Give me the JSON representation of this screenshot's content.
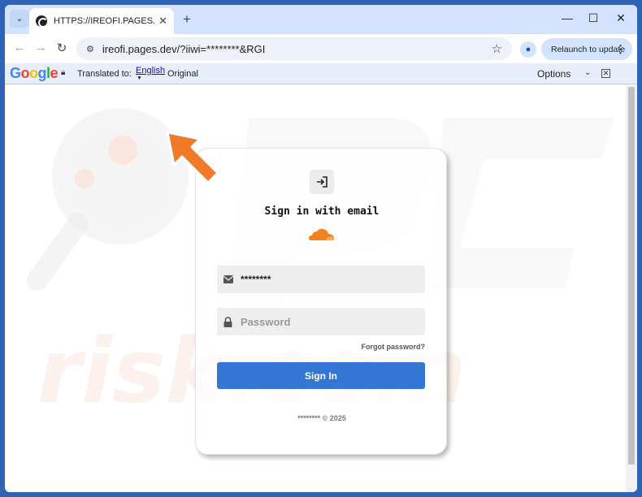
{
  "tab": {
    "title": "HTTPS://IREOFI.PAGES.DEV/?IIW",
    "close": "✕",
    "new_tab": "+"
  },
  "window_controls": {
    "minimize": "—",
    "maximize": "☐",
    "close": "✕"
  },
  "toolbar": {
    "url": "ireofi.pages.dev/?iiwi=********&RGI",
    "relaunch_label": "Relaunch to update"
  },
  "translate_bar": {
    "logo": "Google",
    "translated_to": "Translated to:",
    "language": "English",
    "show_original": "Original",
    "options": "Options"
  },
  "login": {
    "title": "Sign in with email",
    "email_value": "********",
    "password_placeholder": "Password",
    "forgot": "Forgot password?",
    "signin_button": "Sign In",
    "footer": "******** © 2025"
  },
  "colors": {
    "tabstrip": "#d3e3fd",
    "signin_button": "#3476d4",
    "cloudflare_orange": "#f48120",
    "arrow": "#f07a2a"
  },
  "icons": [
    "search-tabs-icon",
    "back-icon",
    "forward-icon",
    "reload-icon",
    "site-info-icon",
    "star-icon",
    "profile-icon",
    "login-icon",
    "cloudflare-icon",
    "email-icon",
    "lock-icon"
  ]
}
